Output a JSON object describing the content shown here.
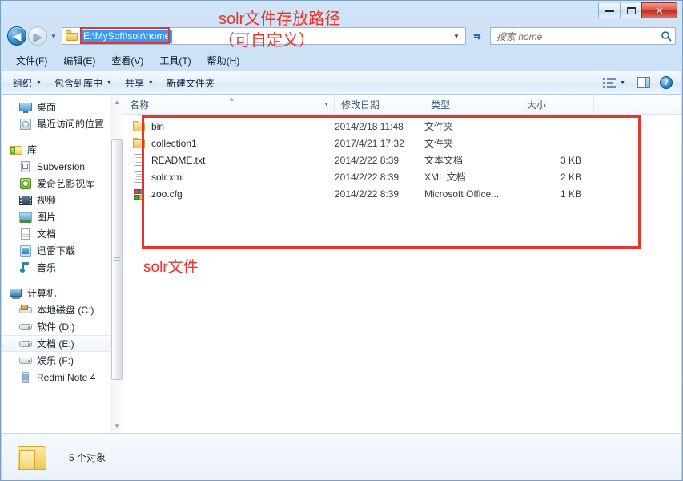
{
  "window": {
    "controls": {
      "minimize": "—",
      "maximize": "❐",
      "close": "✕"
    }
  },
  "address": {
    "back_label": "◀",
    "forward_label": "▶",
    "recent_caret": "▼",
    "path": "E:\\MySoft\\solr\\home",
    "dropdown_caret": "▼",
    "refresh_label": "↻"
  },
  "search": {
    "placeholder": "搜索 home",
    "icon": "search-icon"
  },
  "menu": {
    "items": [
      {
        "label": "文件(F)"
      },
      {
        "label": "编辑(E)"
      },
      {
        "label": "查看(V)"
      },
      {
        "label": "工具(T)"
      },
      {
        "label": "帮助(H)"
      }
    ]
  },
  "toolbar": {
    "organize": "组织",
    "include_in_library": "包含到库中",
    "share": "共享",
    "new_folder": "新建文件夹",
    "caret": "▼",
    "help_glyph": "?"
  },
  "sidebar": {
    "items": [
      {
        "label": "桌面",
        "icon": "desktop-icon",
        "level": 1,
        "gap_before": false
      },
      {
        "label": "最近访问的位置",
        "icon": "recent-places-icon",
        "level": 1,
        "gap_before": false
      },
      {
        "label": "库",
        "icon": "library-icon",
        "level": 0,
        "gap_before": true
      },
      {
        "label": "Subversion",
        "icon": "subversion-icon",
        "level": 1,
        "gap_before": false
      },
      {
        "label": "爱奇艺影视库",
        "icon": "iqiyi-icon",
        "level": 1,
        "gap_before": false
      },
      {
        "label": "视频",
        "icon": "video-icon",
        "level": 1,
        "gap_before": false
      },
      {
        "label": "图片",
        "icon": "pictures-icon",
        "level": 1,
        "gap_before": false
      },
      {
        "label": "文档",
        "icon": "documents-icon",
        "level": 1,
        "gap_before": false
      },
      {
        "label": "迅雷下载",
        "icon": "xunlei-icon",
        "level": 1,
        "gap_before": false
      },
      {
        "label": "音乐",
        "icon": "music-icon",
        "level": 1,
        "gap_before": false
      },
      {
        "label": "计算机",
        "icon": "computer-icon",
        "level": 0,
        "gap_before": true
      },
      {
        "label": "本地磁盘 (C:)",
        "icon": "system-drive-icon",
        "level": 1,
        "gap_before": false
      },
      {
        "label": "软件 (D:)",
        "icon": "drive-icon",
        "level": 1,
        "gap_before": false
      },
      {
        "label": "文档 (E:)",
        "icon": "drive-icon",
        "level": 1,
        "gap_before": false,
        "selected": true
      },
      {
        "label": "娱乐 (F:)",
        "icon": "drive-icon",
        "level": 1,
        "gap_before": false
      },
      {
        "label": "Redmi Note 4",
        "icon": "phone-icon",
        "level": 1,
        "gap_before": false
      }
    ],
    "scroll_up": "▲",
    "scroll_down": "▼"
  },
  "filelist": {
    "columns": [
      {
        "key": "name",
        "label": "名称"
      },
      {
        "key": "date",
        "label": "修改日期"
      },
      {
        "key": "type",
        "label": "类型"
      },
      {
        "key": "size",
        "label": "大小"
      }
    ],
    "sort_mark": "▲",
    "header_caret": "▼",
    "rows": [
      {
        "name": "bin",
        "date": "2014/2/18 11:48",
        "type": "文件夹",
        "size": "",
        "icon": "folder-icon"
      },
      {
        "name": "collection1",
        "date": "2017/4/21 17:32",
        "type": "文件夹",
        "size": "",
        "icon": "folder-icon"
      },
      {
        "name": "README.txt",
        "date": "2014/2/22 8:39",
        "type": "文本文档",
        "size": "3 KB",
        "icon": "text-file-icon"
      },
      {
        "name": "solr.xml",
        "date": "2014/2/22 8:39",
        "type": "XML 文档",
        "size": "2 KB",
        "icon": "xml-file-icon"
      },
      {
        "name": "zoo.cfg",
        "date": "2014/2/22 8:39",
        "type": "Microsoft Office...",
        "size": "1 KB",
        "icon": "config-file-icon"
      }
    ]
  },
  "annotations": {
    "title_line1": "solr文件存放路径",
    "title_line2": "（可自定义）",
    "files_label": "solr文件",
    "color": "#e8342a"
  },
  "statusbar": {
    "text": "5 个对象",
    "icon": "folder-icon"
  }
}
